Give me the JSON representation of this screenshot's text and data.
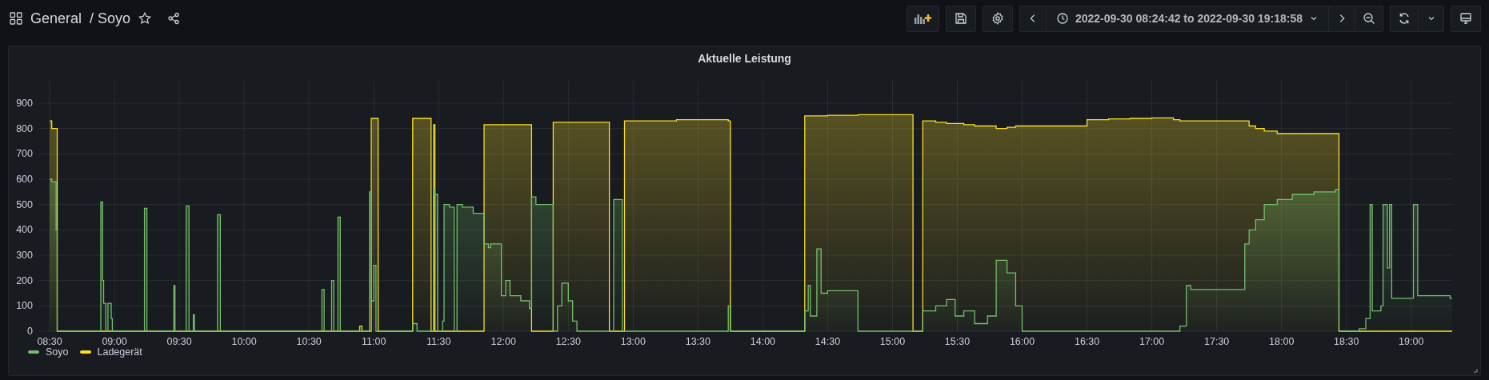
{
  "header": {
    "folder": "General",
    "dashboard": "/ Soyo",
    "time_range": "2022-09-30 08:24:42 to 2022-09-30 19:18:58"
  },
  "panel": {
    "title": "Aktuelle Leistung",
    "chart_data": {
      "type": "area",
      "x": [
        510,
        511,
        513,
        513.5,
        533.7,
        534.5,
        535,
        536,
        537,
        538.5,
        539,
        553.9,
        555,
        567.5,
        568,
        573.2,
        574.5,
        576.5,
        577,
        587.7,
        589,
        636,
        637,
        640.5,
        641.5,
        643.4,
        644.5,
        653.5,
        654.5,
        658,
        658.8,
        660,
        661,
        662,
        678,
        680,
        686.5,
        687.7,
        688.3,
        689.5,
        691.8,
        692.5,
        695,
        697.2,
        698.5,
        701,
        706,
        711,
        713,
        714,
        719,
        721,
        723,
        728,
        732,
        733,
        735,
        743,
        745,
        747,
        750,
        752,
        754,
        769,
        771,
        775,
        776,
        800,
        824,
        825,
        859.4,
        861,
        862,
        865,
        867,
        870,
        884,
        909.5,
        914,
        920,
        925,
        929,
        933,
        938,
        944,
        948,
        953,
        957,
        960,
        990,
        1000,
        1010,
        1020,
        1030,
        1033,
        1036,
        1038,
        1063,
        1065,
        1068,
        1072,
        1078,
        1085,
        1095,
        1105,
        1106.6,
        1116,
        1119,
        1121,
        1122,
        1126,
        1127,
        1129,
        1130,
        1131,
        1141,
        1143,
        1158
      ],
      "series": [
        {
          "name": "Soyo",
          "color": "#73bf69",
          "values": [
            600,
            590,
            400,
            0,
            510,
            200,
            110,
            0,
            110,
            50,
            0,
            485,
            0,
            180,
            0,
            495,
            0,
            65,
            0,
            460,
            0,
            165,
            0,
            200,
            0,
            450,
            0,
            0,
            0,
            550,
            120,
            260,
            0,
            0,
            30,
            0,
            0,
            560,
            540,
            0,
            40,
            500,
            490,
            0,
            500,
            490,
            465,
            345,
            330,
            345,
            140,
            200,
            140,
            120,
            90,
            530,
            500,
            0,
            100,
            190,
            120,
            40,
            0,
            0,
            520,
            0,
            0,
            0,
            100,
            0,
            80,
            180,
            60,
            325,
            150,
            160,
            0,
            0,
            80,
            100,
            125,
            60,
            80,
            30,
            60,
            280,
            230,
            100,
            0,
            0,
            0,
            0,
            0,
            0,
            20,
            180,
            165,
            345,
            400,
            440,
            500,
            520,
            540,
            550,
            560,
            0,
            10,
            50,
            500,
            80,
            100,
            500,
            250,
            500,
            130,
            500,
            140,
            130
          ]
        },
        {
          "name": "Ladegerät",
          "color": "#fade2a",
          "values": [
            830,
            800,
            800,
            0,
            0,
            0,
            0,
            0,
            0,
            0,
            0,
            0,
            0,
            0,
            0,
            0,
            0,
            0,
            0,
            0,
            0,
            0,
            0,
            0,
            0,
            0,
            0,
            20,
            0,
            0,
            840,
            840,
            840,
            0,
            840,
            840,
            0,
            815,
            0,
            0,
            0,
            0,
            0,
            0,
            0,
            0,
            0,
            815,
            815,
            815,
            815,
            815,
            815,
            815,
            815,
            0,
            0,
            825,
            825,
            825,
            825,
            825,
            825,
            0,
            0,
            0,
            830,
            835,
            830,
            0,
            850,
            850,
            850,
            850,
            850,
            852,
            855,
            0,
            830,
            825,
            820,
            820,
            815,
            810,
            810,
            800,
            805,
            810,
            810,
            835,
            838,
            840,
            842,
            835,
            830,
            830,
            830,
            830,
            810,
            800,
            790,
            780,
            780,
            780,
            780,
            0,
            0,
            0,
            0,
            0,
            0,
            0,
            0,
            0,
            0,
            0,
            0,
            0
          ]
        }
      ],
      "xticks": [
        {
          "value": 510,
          "label": "08:30"
        },
        {
          "value": 540,
          "label": "09:00"
        },
        {
          "value": 570,
          "label": "09:30"
        },
        {
          "value": 600,
          "label": "10:00"
        },
        {
          "value": 630,
          "label": "10:30"
        },
        {
          "value": 660,
          "label": "11:00"
        },
        {
          "value": 690,
          "label": "11:30"
        },
        {
          "value": 720,
          "label": "12:00"
        },
        {
          "value": 750,
          "label": "12:30"
        },
        {
          "value": 780,
          "label": "13:00"
        },
        {
          "value": 810,
          "label": "13:30"
        },
        {
          "value": 840,
          "label": "14:00"
        },
        {
          "value": 870,
          "label": "14:30"
        },
        {
          "value": 900,
          "label": "15:00"
        },
        {
          "value": 930,
          "label": "15:30"
        },
        {
          "value": 960,
          "label": "16:00"
        },
        {
          "value": 990,
          "label": "16:30"
        },
        {
          "value": 1020,
          "label": "17:00"
        },
        {
          "value": 1050,
          "label": "17:30"
        },
        {
          "value": 1080,
          "label": "18:00"
        },
        {
          "value": 1110,
          "label": "18:30"
        },
        {
          "value": 1140,
          "label": "19:00"
        }
      ],
      "yticks": [
        0,
        100,
        200,
        300,
        400,
        500,
        600,
        700,
        800,
        900
      ],
      "xlim": [
        504.7,
        1158.97
      ],
      "ylim": [
        0,
        900
      ],
      "grid": true
    }
  }
}
